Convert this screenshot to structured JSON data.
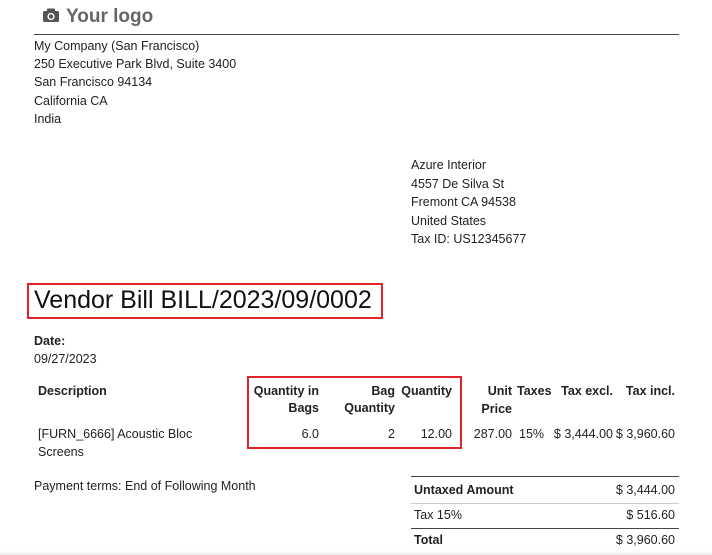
{
  "logo": {
    "icon": "camera-icon",
    "text": "Your logo"
  },
  "company": {
    "name": "My Company (San Francisco)",
    "street": "250 Executive Park Blvd, Suite 3400",
    "city_zip": "San Francisco 94134",
    "state": "California CA",
    "country": "India"
  },
  "vendor": {
    "name": "Azure Interior",
    "street": "4557 De Silva St",
    "city_zip": "Fremont CA 94538",
    "country": "United States",
    "tax_id": "Tax ID: US12345677"
  },
  "bill": {
    "title": "Vendor Bill BILL/2023/09/0002",
    "date_label": "Date:",
    "date": "09/27/2023"
  },
  "table": {
    "headers": {
      "description": "Description",
      "qty_in_bags_1": "Quantity in",
      "qty_in_bags_2": "Bags",
      "bag_qty_1": "Bag",
      "bag_qty_2": "Quantity",
      "quantity": "Quantity",
      "unit_price_1": "Unit",
      "unit_price_2": "Price",
      "taxes": "Taxes",
      "tax_excl": "Tax excl.",
      "tax_incl": "Tax incl."
    },
    "rows": [
      {
        "description_1": "[FURN_6666] Acoustic Bloc",
        "description_2": "Screens",
        "qty_in_bags": "6.0",
        "bag_quantity": "2",
        "quantity": "12.00",
        "unit_price": "287.00",
        "taxes": "15%",
        "tax_excl": "$ 3,444.00",
        "tax_incl": "$ 3,960.60"
      }
    ]
  },
  "payment_terms": "Payment terms: End of Following Month",
  "totals": {
    "untaxed_label": "Untaxed Amount",
    "untaxed_value": "$ 3,444.00",
    "tax_label": "Tax 15%",
    "tax_value": "$ 516.60",
    "total_label": "Total",
    "total_value": "$ 3,960.60"
  },
  "highlight_color": "#e2252b"
}
